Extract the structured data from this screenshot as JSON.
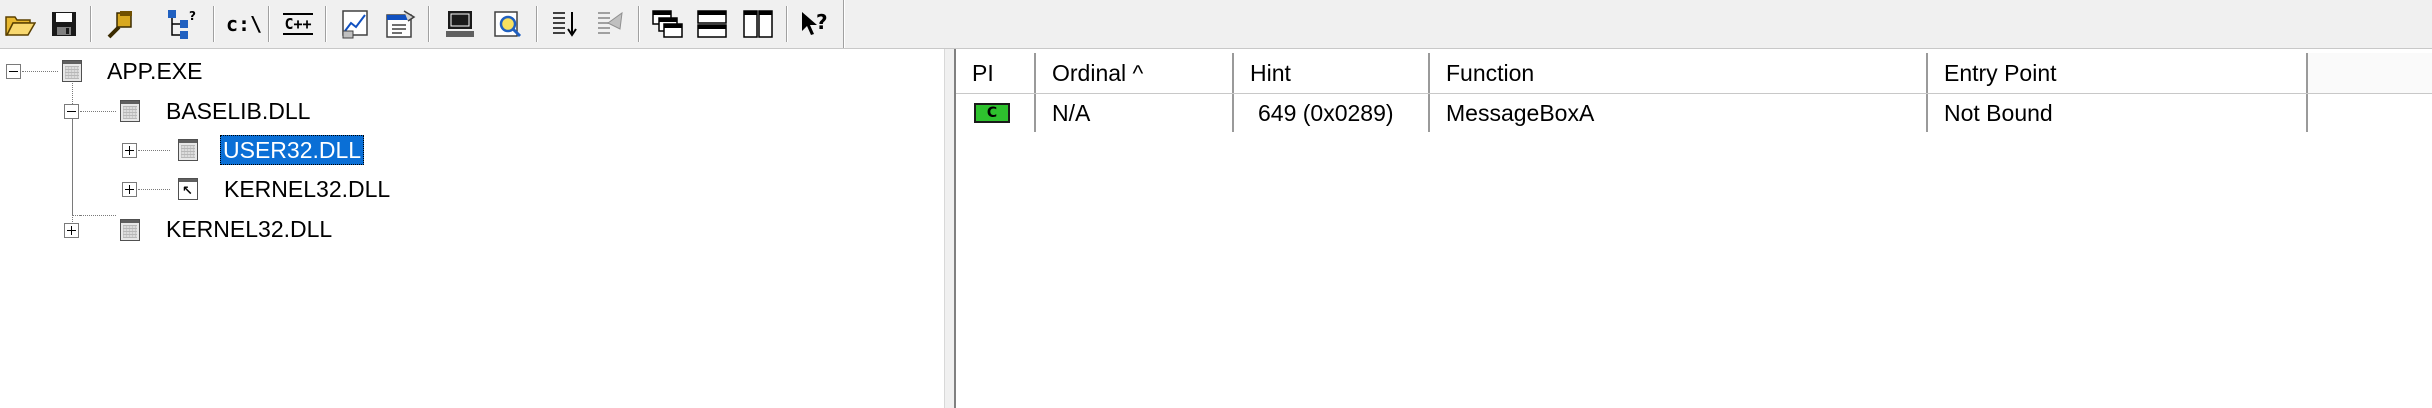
{
  "toolbar": {
    "buttons": [
      {
        "name": "open-icon",
        "label": ""
      },
      {
        "name": "save-icon",
        "label": ""
      },
      {
        "name": "find-icon",
        "label": ""
      },
      {
        "name": "dependency-icon",
        "label": ""
      },
      {
        "name": "path-icon",
        "label": "c:\\"
      },
      {
        "name": "cpp-icon",
        "label": "C++"
      },
      {
        "name": "profile-icon",
        "label": ""
      },
      {
        "name": "properties-icon",
        "label": ""
      },
      {
        "name": "system-info-icon",
        "label": ""
      },
      {
        "name": "view-module-icon",
        "label": ""
      },
      {
        "name": "sort-icon",
        "label": ""
      },
      {
        "name": "external-viewer-icon",
        "label": ""
      },
      {
        "name": "cascade-icon",
        "label": ""
      },
      {
        "name": "tile-horizontal-icon",
        "label": ""
      },
      {
        "name": "tile-vertical-icon",
        "label": ""
      },
      {
        "name": "help-icon",
        "label": ""
      }
    ]
  },
  "tree": {
    "nodes": [
      {
        "label": "APP.EXE",
        "icon": "module-icon",
        "expander": "minus",
        "selected": false
      },
      {
        "label": "BASELIB.DLL",
        "icon": "module-icon",
        "expander": "minus",
        "selected": false
      },
      {
        "label": "USER32.DLL",
        "icon": "module-icon",
        "expander": "plus",
        "selected": true
      },
      {
        "label": "KERNEL32.DLL",
        "icon": "forwarded-module-icon",
        "expander": "plus",
        "selected": false
      },
      {
        "label": "KERNEL32.DLL",
        "icon": "module-icon",
        "expander": "plus",
        "selected": false
      }
    ]
  },
  "list": {
    "columns": [
      "PI",
      "Ordinal ^",
      "Hint",
      "Function",
      "Entry Point"
    ],
    "rows": [
      {
        "pi": "C",
        "pi_color": "#2ec22e",
        "ordinal": "N/A",
        "hint": "649 (0x0289)",
        "function": "MessageBoxA",
        "entry_point": "Not Bound"
      }
    ]
  },
  "colors": {
    "selection": "#0a6fd6",
    "toolbar_bg": "#f0f0f0",
    "pi_c_badge": "#2ec22e"
  }
}
